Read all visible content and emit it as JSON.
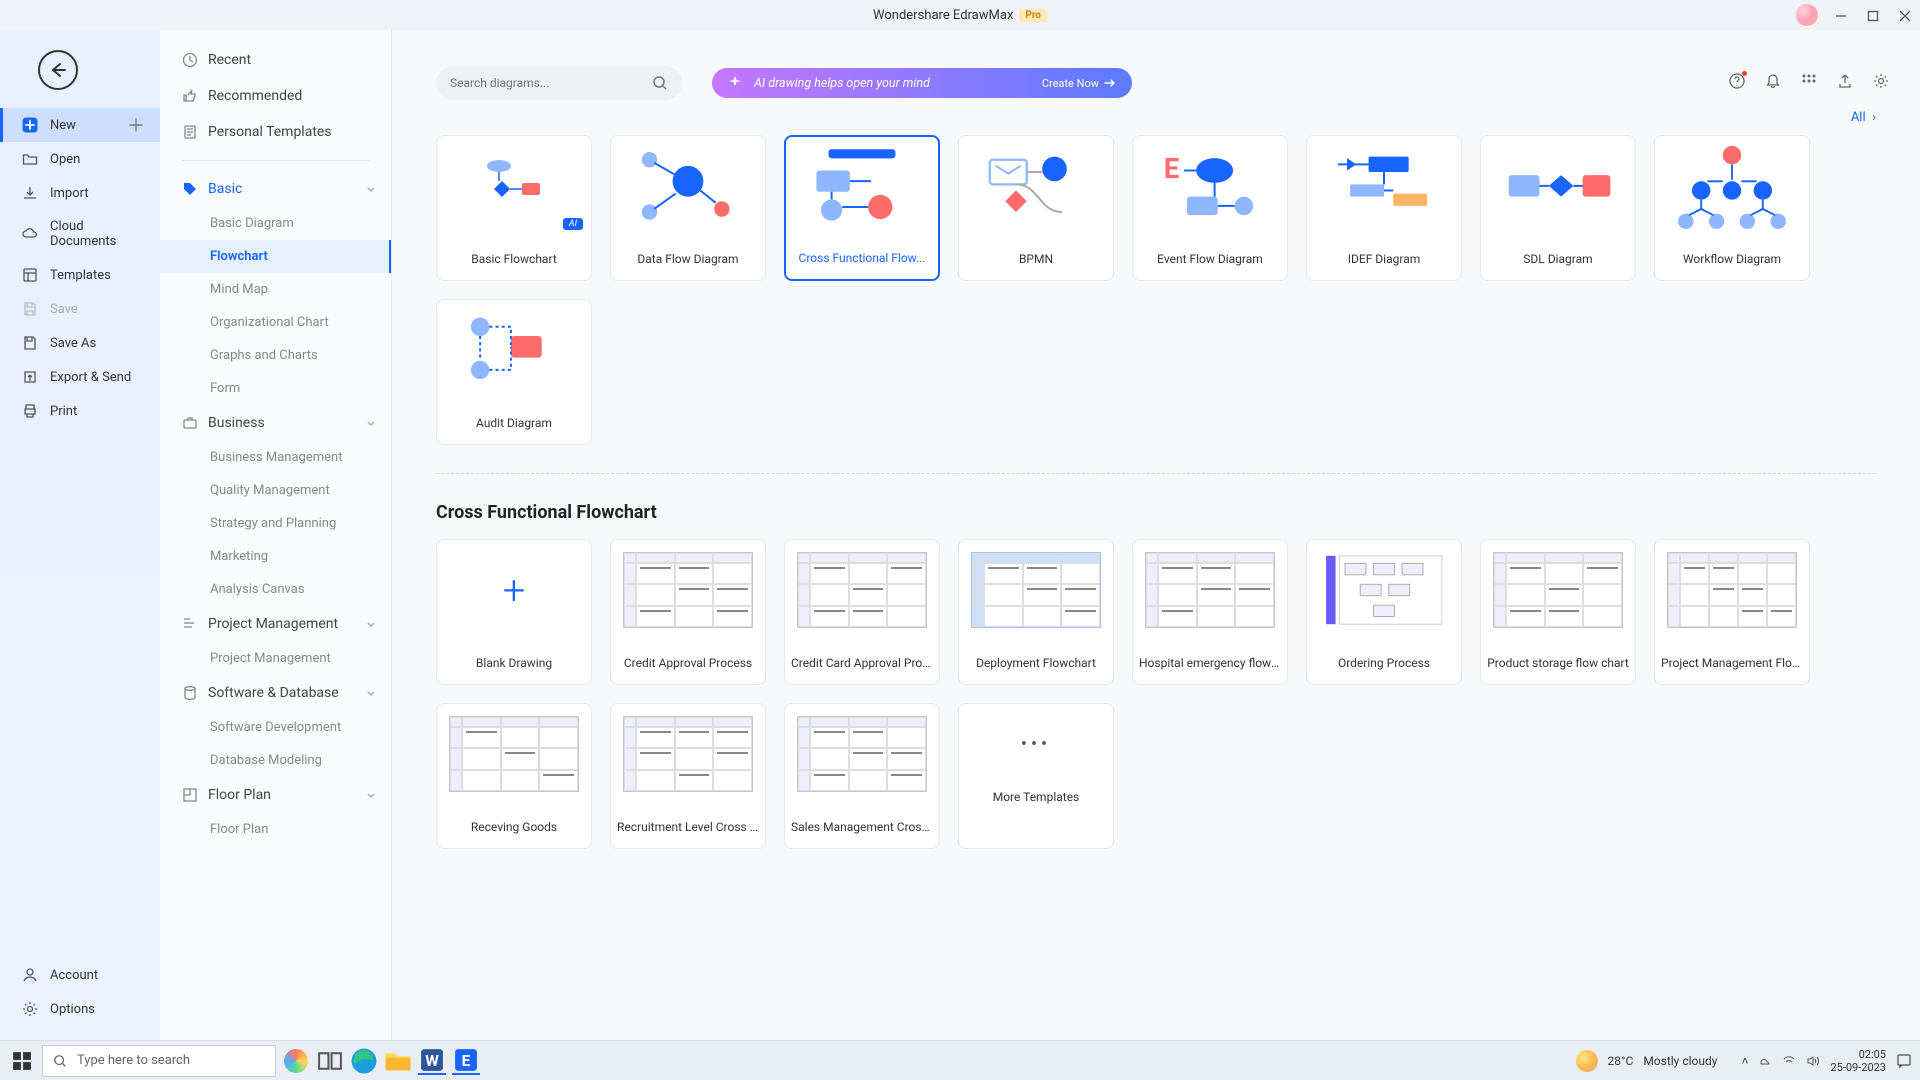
{
  "window": {
    "title": "Wondershare EdrawMax",
    "pro_label": "Pro"
  },
  "rail": {
    "new": "New",
    "open": "Open",
    "import": "Import",
    "cloud_docs": "Cloud Documents",
    "templates": "Templates",
    "save": "Save",
    "save_as": "Save As",
    "export_send": "Export & Send",
    "print": "Print",
    "account": "Account",
    "options": "Options"
  },
  "categories": {
    "recent": "Recent",
    "recommended": "Recommended",
    "personal_templates": "Personal Templates",
    "basic": {
      "label": "Basic",
      "items": [
        "Basic Diagram",
        "Flowchart",
        "Mind Map",
        "Organizational Chart",
        "Graphs and Charts",
        "Form"
      ],
      "active_index": 1
    },
    "business": {
      "label": "Business",
      "items": [
        "Business Management",
        "Quality Management",
        "Strategy and Planning",
        "Marketing",
        "Analysis Canvas"
      ]
    },
    "project_mgmt": {
      "label": "Project Management",
      "items": [
        "Project Management"
      ]
    },
    "software_db": {
      "label": "Software & Database",
      "items": [
        "Software Development",
        "Database Modeling"
      ]
    },
    "floor_plan": {
      "label": "Floor Plan",
      "items": [
        "Floor Plan"
      ]
    }
  },
  "search": {
    "placeholder": "Search diagrams..."
  },
  "ai_banner": {
    "text": "AI drawing helps open your mind",
    "cta": "Create Now"
  },
  "all_link": "All",
  "diagram_types": [
    {
      "label": "Basic Flowchart",
      "ai": true
    },
    {
      "label": "Data Flow Diagram"
    },
    {
      "label": "Cross Functional Flow...",
      "selected": true
    },
    {
      "label": "BPMN"
    },
    {
      "label": "Event Flow Diagram"
    },
    {
      "label": "IDEF Diagram"
    },
    {
      "label": "SDL Diagram"
    },
    {
      "label": "Workflow Diagram"
    },
    {
      "label": "Audit Diagram"
    }
  ],
  "section_title": "Cross Functional Flowchart",
  "templates": [
    {
      "label": "Blank Drawing",
      "blank": true
    },
    {
      "label": "Credit Approval Process"
    },
    {
      "label": "Credit Card Approval Proc..."
    },
    {
      "label": "Deployment Flowchart"
    },
    {
      "label": "Hospital emergency flow c..."
    },
    {
      "label": "Ordering Process"
    },
    {
      "label": "Product storage flow chart"
    },
    {
      "label": "Project Management Flow..."
    },
    {
      "label": "Receving Goods"
    },
    {
      "label": "Recruitment Level Cross F..."
    },
    {
      "label": "Sales Management Crossf..."
    },
    {
      "label": "More Templates",
      "more": true
    }
  ],
  "taskbar": {
    "search_placeholder": "Type here to search",
    "weather_temp": "28°C",
    "weather_text": "Mostly cloudy",
    "time": "02:05",
    "date": "25-09-2023"
  }
}
